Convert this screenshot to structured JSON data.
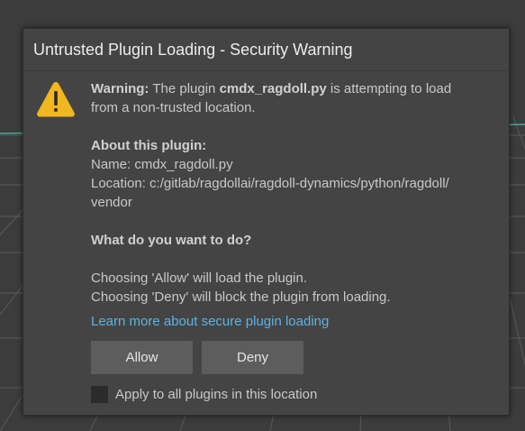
{
  "dialog": {
    "title": "Untrusted Plugin Loading - Security Warning",
    "icon": "warning-triangle-icon",
    "warning_label": "Warning:",
    "warning_text_1": " The plugin ",
    "plugin_name": "cmdx_ragdoll.py",
    "warning_text_2": " is attempting to load",
    "warning_text_3": "from a non-trusted location.",
    "about_heading": "About this plugin:",
    "name_line": "Name: cmdx_ragdoll.py",
    "location_line_1": "Location: c:/gitlab/ragdollai/ragdoll-dynamics/python/ragdoll/",
    "location_line_2": "vendor",
    "question_heading": "What do you want to do?",
    "allow_explain": "Choosing 'Allow' will load the plugin.",
    "deny_explain": "Choosing 'Deny' will block the plugin from loading.",
    "learn_more_link": "Learn more about secure plugin loading",
    "allow_button": "Allow",
    "deny_button": "Deny",
    "apply_all_label": "Apply to all plugins in this location",
    "apply_all_checked": false
  },
  "colors": {
    "dialog_bg": "#444444",
    "viewport_bg": "#3c3c3c",
    "link": "#5ab4e6",
    "icon_fill": "#f2b61e",
    "button_bg": "#5d5d5d"
  }
}
